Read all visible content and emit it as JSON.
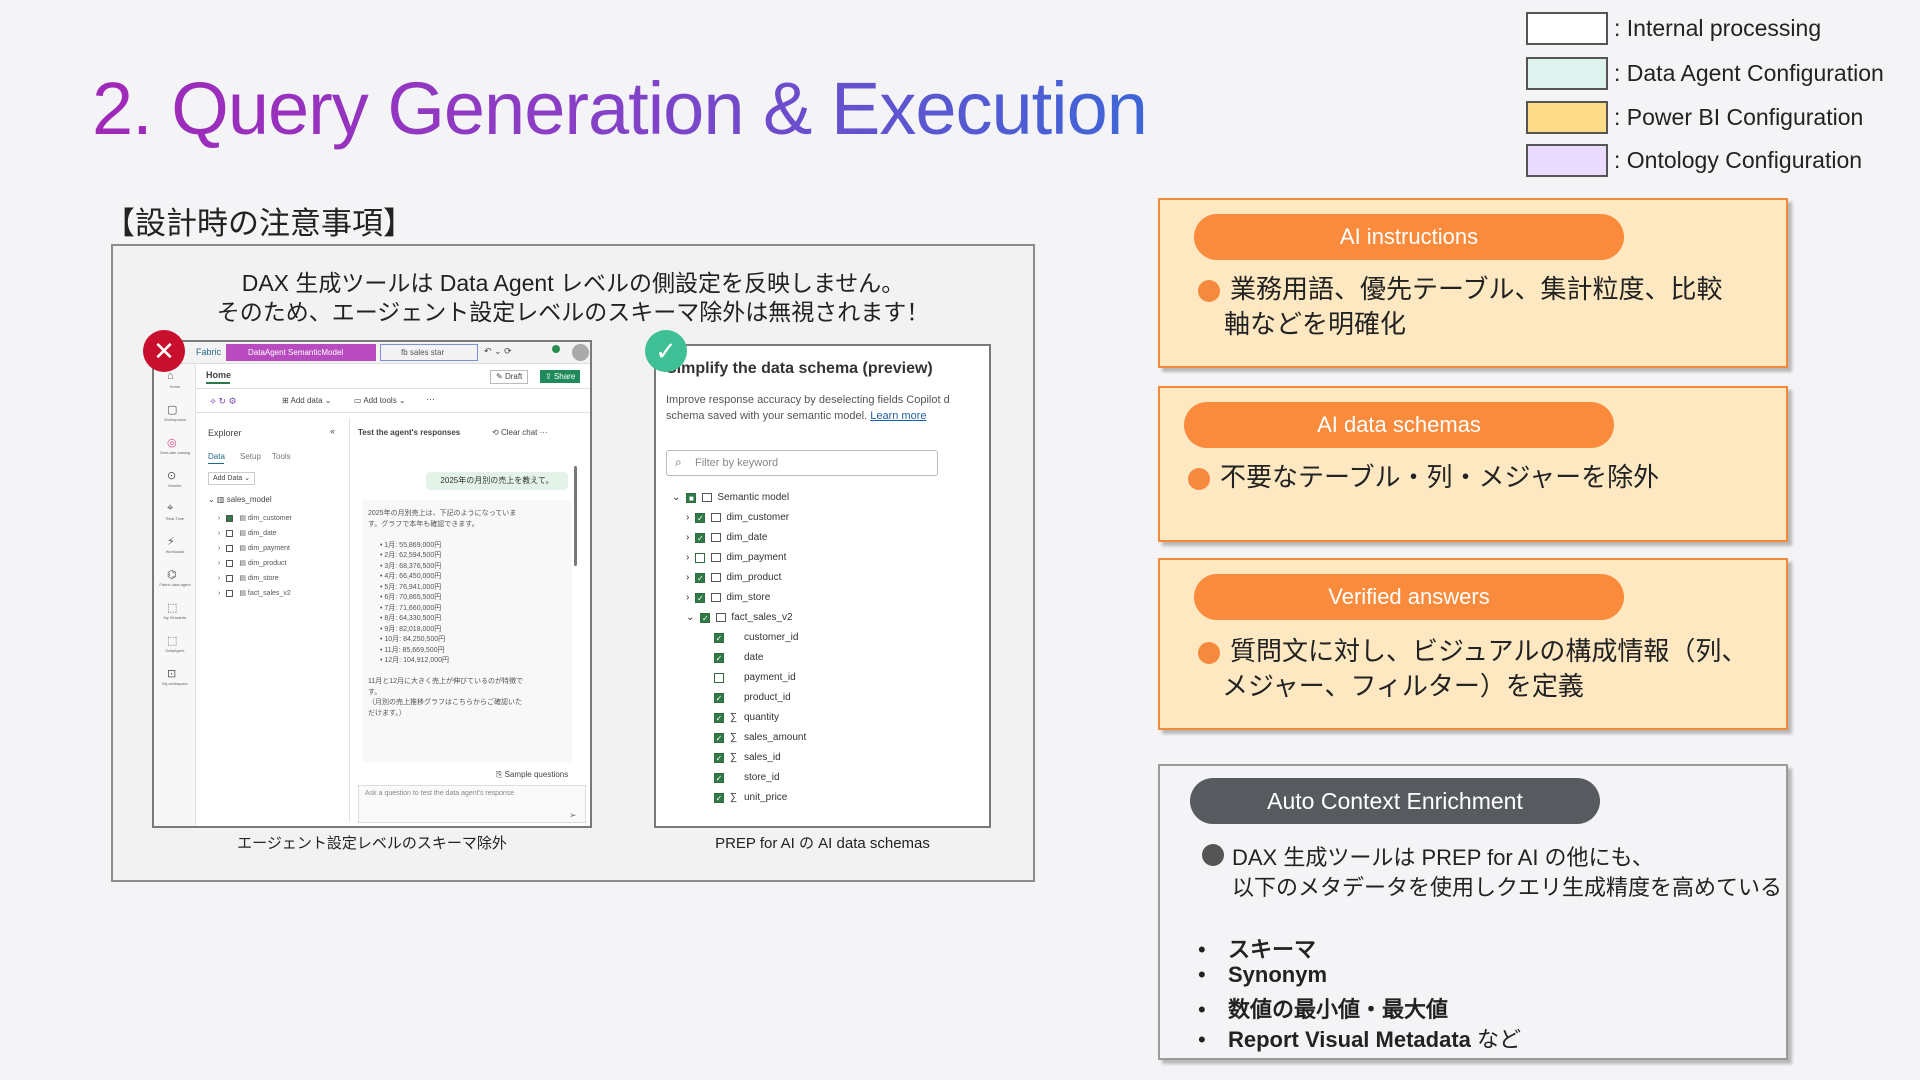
{
  "title": "2. Query Generation & Execution",
  "legend": [
    {
      "label": ": Internal processing",
      "color": "#ffffff"
    },
    {
      "label": ": Data Agent Configuration",
      "color": "#dff3ee"
    },
    {
      "label": ": Power BI Configuration",
      "color": "#fcdc88"
    },
    {
      "label": ": Ontology Configuration",
      "color": "#e9dcff"
    }
  ],
  "notes_heading": "【設計時の注意事項】",
  "panel": {
    "line1": "DAX 生成ツールは Data Agent レベルの側設定を反映しません。",
    "line2": "そのため、エージェント設定レベルのスキーマ除外は無視されます！",
    "left_caption": "エージェント設定レベルのスキーマ除外",
    "right_caption": "PREP for AI の AI data schemas"
  },
  "fabric": {
    "brand": "Fabric",
    "tab1": "DataAgent SemanticModel",
    "tab2": "fb sales star",
    "home": "Home",
    "draft": "Draft",
    "share": "Share",
    "add_data": "Add data",
    "add_tools": "Add tools",
    "explorer": "Explorer",
    "tabs": [
      "Data",
      "Setup",
      "Tools"
    ],
    "add_data_small": "Add Data",
    "tree_root": "sales_model",
    "tree_items": [
      "dim_customer",
      "dim_date",
      "dim_payment",
      "dim_product",
      "dim_store",
      "fact_sales_v2"
    ],
    "test_title": "Test the agent's responses",
    "clear_chat": "Clear chat",
    "user_msg": "2025年の月別の売上を教えて。",
    "reply_intro": [
      "2025年の月別売上は、下記のようになっていま",
      "す。グラフで本年も確認できます。"
    ],
    "reply_list": [
      "1月: 55,869,000円",
      "2月: 62,594,500円",
      "3月: 68,376,500円",
      "4月: 66,450,000円",
      "5月: 76,941,000円",
      "6月: 70,865,500円",
      "7月: 71,660,000円",
      "8月: 64,330,500円",
      "9月: 82,018,000円",
      "10月: 84,250,500円",
      "11月: 85,669,500円",
      "12月: 104,912,000円"
    ],
    "reply_outro": [
      "11月と12月に大きく売上が伸びているのが特徴で",
      "す。",
      "（月別の売上推移グラフはこちらからご確認いた",
      "だけます。）"
    ],
    "sample_questions": "Sample questions",
    "ask_placeholder": "Ask a question to test the data agent's response",
    "sidebar_labels": [
      "Home",
      "Workspaces",
      "OneLake catalog",
      "Monitor",
      "Real-Time",
      "Workloads",
      "Fabric data agent",
      "My Semantic",
      "DataAgent",
      "My workspace"
    ]
  },
  "prep": {
    "title": "Simplify the data schema (preview)",
    "desc1": "Improve response accuracy by deselecting fields Copilot d",
    "desc2": "schema saved with your semantic model.",
    "learn_more": "Learn more",
    "filter_placeholder": "Filter by keyword",
    "model": "Semantic model",
    "tables": [
      {
        "name": "dim_customer",
        "checked": true
      },
      {
        "name": "dim_date",
        "checked": true
      },
      {
        "name": "dim_payment",
        "checked": false
      },
      {
        "name": "dim_product",
        "checked": true
      },
      {
        "name": "dim_store",
        "checked": true
      },
      {
        "name": "fact_sales_v2",
        "checked": true
      }
    ],
    "columns": [
      {
        "name": "customer_id",
        "checked": true,
        "sigma": false
      },
      {
        "name": "date",
        "checked": true,
        "sigma": false
      },
      {
        "name": "payment_id",
        "checked": false,
        "sigma": false
      },
      {
        "name": "product_id",
        "checked": true,
        "sigma": false
      },
      {
        "name": "quantity",
        "checked": true,
        "sigma": true
      },
      {
        "name": "sales_amount",
        "checked": true,
        "sigma": true
      },
      {
        "name": "sales_id",
        "checked": true,
        "sigma": true
      },
      {
        "name": "store_id",
        "checked": true,
        "sigma": false
      },
      {
        "name": "unit_price",
        "checked": true,
        "sigma": true
      }
    ]
  },
  "cards": {
    "ai_instructions": {
      "label": "AI instructions",
      "line1": "業務用語、優先テーブル、集計粒度、比較",
      "line2": "軸などを明確化"
    },
    "ai_data_schemas": {
      "label": "AI data schemas",
      "line1": "不要なテーブル・列・メジャーを除外"
    },
    "verified_answers": {
      "label": "Verified answers",
      "line1": "質問文に対し、ビジュアルの構成情報（列、",
      "line2": "メジャー、フィルター）を定義"
    }
  },
  "ace": {
    "label": "Auto Context Enrichment",
    "line1": "DAX 生成ツールは PREP for AI の他にも、",
    "line2": "以下のメタデータを使用しクエリ生成精度を高めている",
    "items": [
      "スキーマ",
      "Synonym",
      "数値の最小値・最大値",
      "Report Visual Metadata"
    ],
    "items_suffix": "など"
  }
}
